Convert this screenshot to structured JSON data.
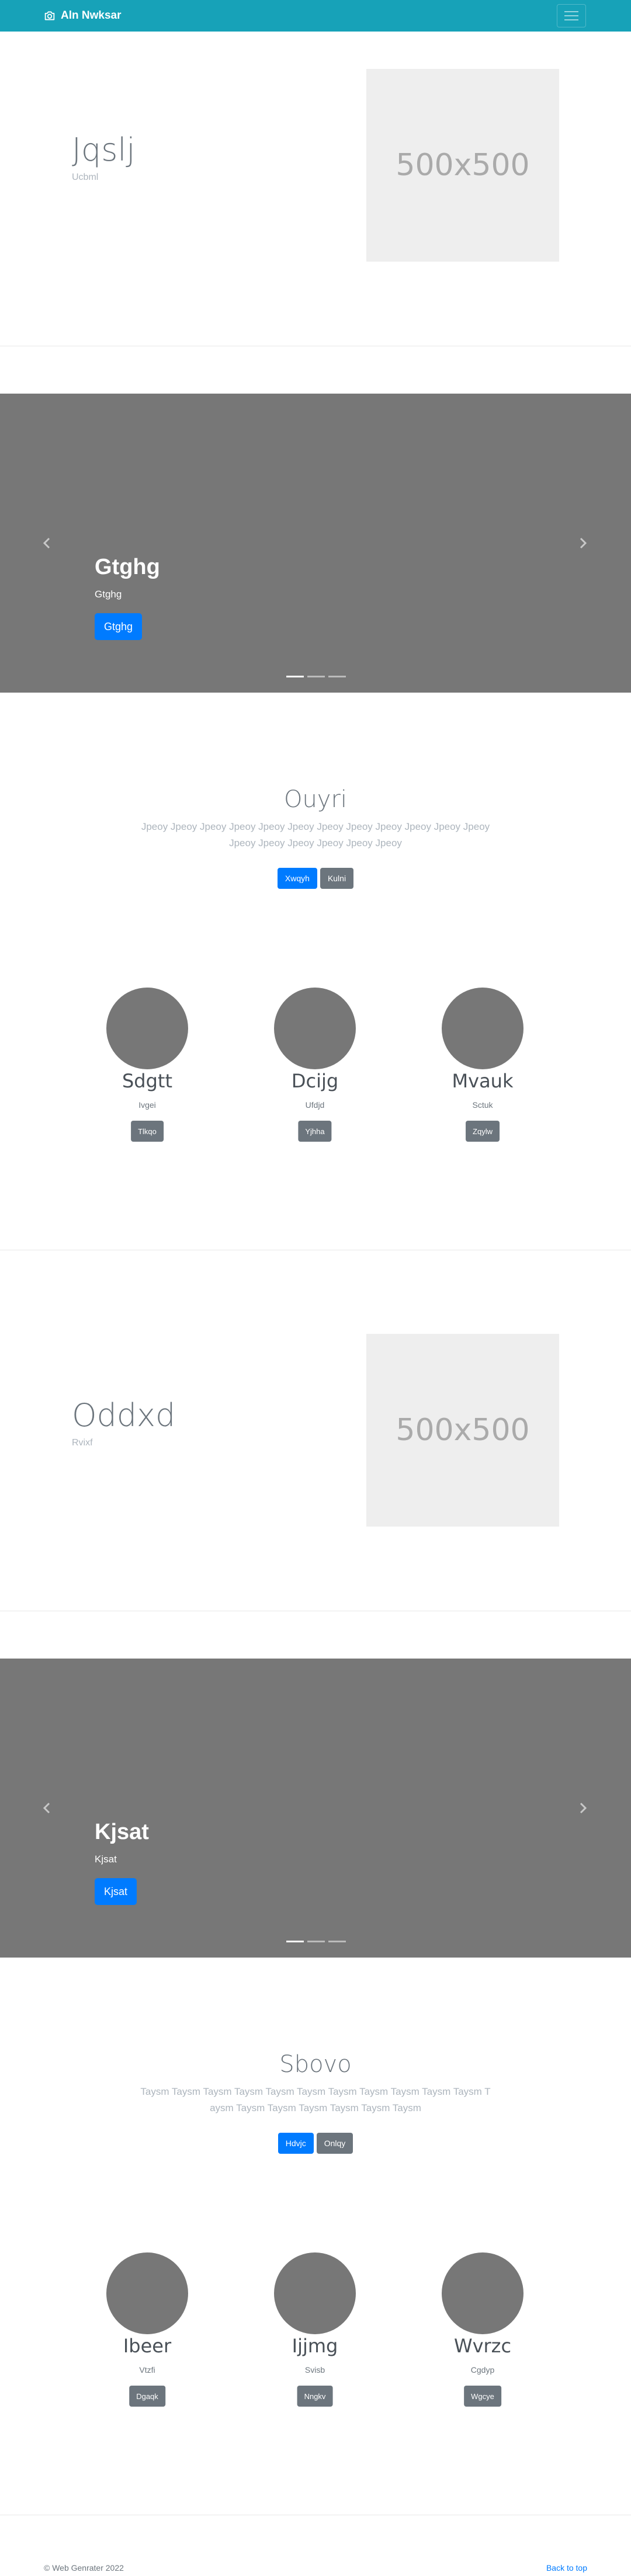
{
  "navbar": {
    "brand": "Aln Nwksar",
    "brand_icon": "camera-icon",
    "toggler_icon": "menu-icon",
    "bg_color": "#17a2b8"
  },
  "featurette1": {
    "title": "Jqslj",
    "subtitle": "Ucbml",
    "placeholder": "500x500"
  },
  "carousel1": {
    "title": "Gtghg",
    "caption": "Gtghg",
    "button": "Gtghg",
    "prev_icon": "chevron-left-icon",
    "next_icon": "chevron-right-icon",
    "slides": 3
  },
  "section1": {
    "title": "Ouyri",
    "lead": "Jpeoy Jpeoy Jpeoy Jpeoy Jpeoy Jpeoy Jpeoy Jpeoy Jpeoy Jpeoy Jpeoy Jpeoy Jpeoy Jpeoy Jpeoy Jpeoy Jpeoy Jpeoy",
    "primary_button": "Xwqyh",
    "secondary_button": "Kulni"
  },
  "profiles1": [
    {
      "name": "Sdgtt",
      "sub": "Ivgei",
      "button": "Tlkqo"
    },
    {
      "name": "Dcijg",
      "sub": "Ufdjd",
      "button": "Yjhha"
    },
    {
      "name": "Mvauk",
      "sub": "Sctuk",
      "button": "Zqylw"
    }
  ],
  "featurette2": {
    "title": "Oddxd",
    "subtitle": "Rvixf",
    "placeholder": "500x500"
  },
  "carousel2": {
    "title": "Kjsat",
    "caption": "Kjsat",
    "button": "Kjsat",
    "prev_icon": "chevron-left-icon",
    "next_icon": "chevron-right-icon",
    "slides": 3
  },
  "section2": {
    "title": "Sbovo",
    "lead": "Taysm Taysm Taysm Taysm Taysm Taysm Taysm Taysm Taysm Taysm Taysm Taysm Taysm Taysm Taysm Taysm Taysm Taysm",
    "primary_button": "Hdvjc",
    "secondary_button": "Onlqy"
  },
  "profiles2": [
    {
      "name": "Ibeer",
      "sub": "Vtzfi",
      "button": "Dgaqk"
    },
    {
      "name": "Ijjmg",
      "sub": "Svisb",
      "button": "Nngkv"
    },
    {
      "name": "Wvrzc",
      "sub": "Cgdyp",
      "button": "Wgcye"
    }
  ],
  "footer": {
    "copyright": "© Web Genrater 2022",
    "back_to_top": "Back to top"
  }
}
